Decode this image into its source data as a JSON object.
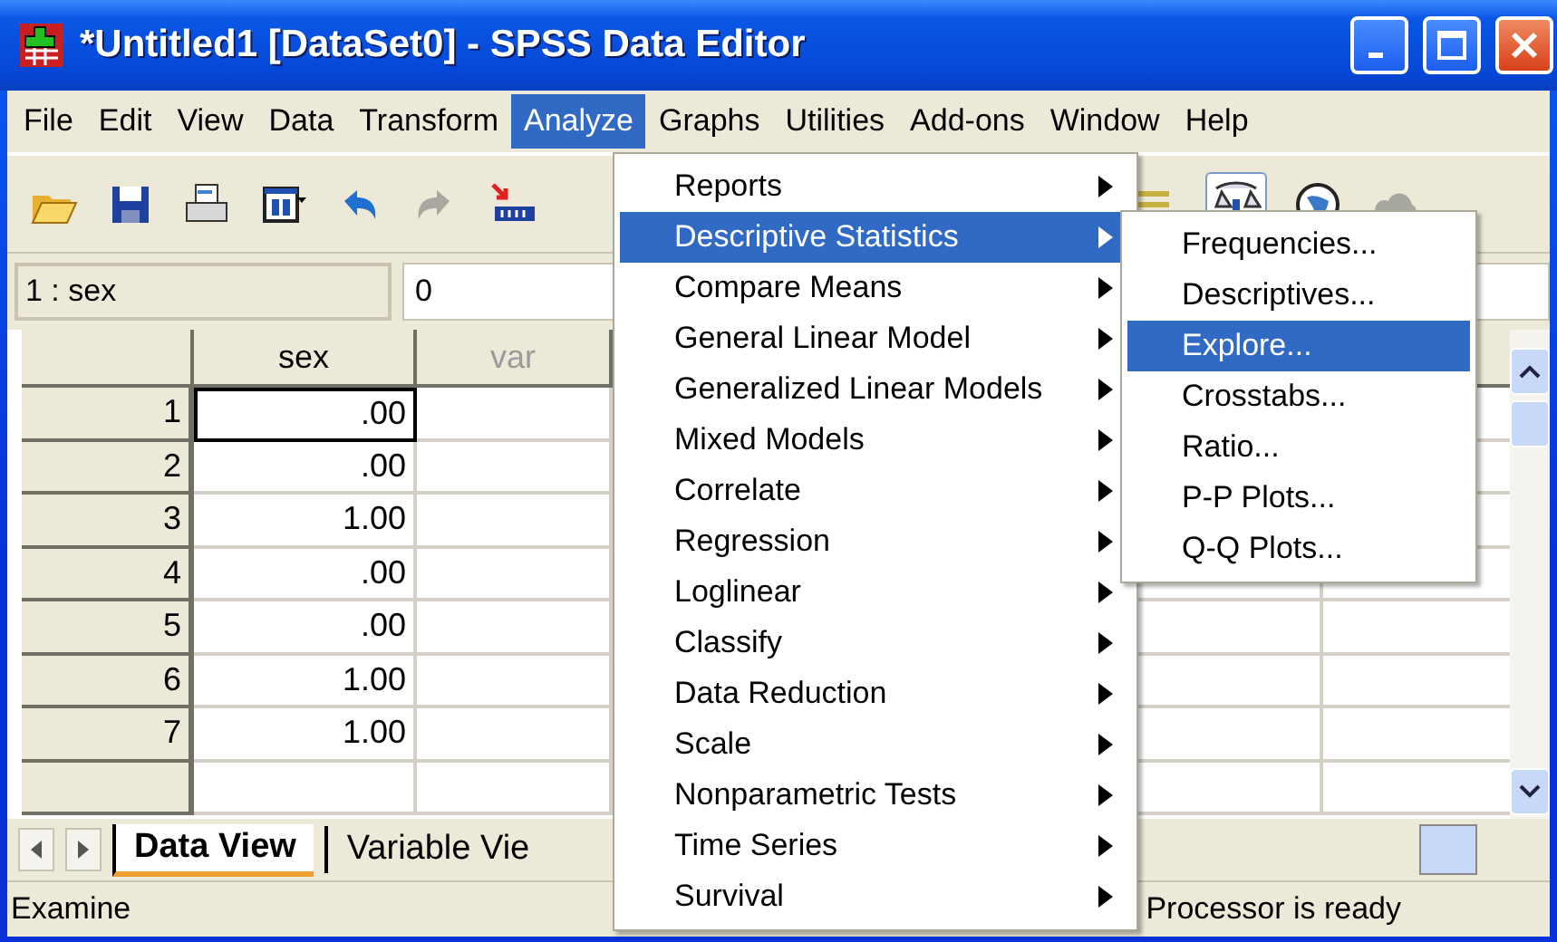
{
  "window": {
    "title": "*Untitled1 [DataSet0] - SPSS Data Editor"
  },
  "menubar": [
    {
      "label": "File",
      "selected": false
    },
    {
      "label": "Edit",
      "selected": false
    },
    {
      "label": "View",
      "selected": false
    },
    {
      "label": "Data",
      "selected": false
    },
    {
      "label": "Transform",
      "selected": false
    },
    {
      "label": "Analyze",
      "selected": true
    },
    {
      "label": "Graphs",
      "selected": false
    },
    {
      "label": "Utilities",
      "selected": false
    },
    {
      "label": "Add-ons",
      "selected": false
    },
    {
      "label": "Window",
      "selected": false
    },
    {
      "label": "Help",
      "selected": false
    }
  ],
  "cell_reference": {
    "name": "1 : sex",
    "value": "0"
  },
  "table": {
    "columns": [
      "sex",
      "var"
    ],
    "rows": [
      {
        "number": "1",
        "sex": ".00",
        "selected": true
      },
      {
        "number": "2",
        "sex": ".00",
        "selected": false
      },
      {
        "number": "3",
        "sex": "1.00",
        "selected": false
      },
      {
        "number": "4",
        "sex": ".00",
        "selected": false
      },
      {
        "number": "5",
        "sex": ".00",
        "selected": false
      },
      {
        "number": "6",
        "sex": "1.00",
        "selected": false
      },
      {
        "number": "7",
        "sex": "1.00",
        "selected": false
      }
    ]
  },
  "sheet_tabs": [
    {
      "label": "Data View",
      "selected": true
    },
    {
      "label": "Variable Vie",
      "selected": false
    }
  ],
  "status_bar": {
    "message": "Examine",
    "processor": "Processor is ready"
  },
  "analyze_menu": [
    {
      "label": "Reports",
      "selected": false
    },
    {
      "label": "Descriptive Statistics",
      "selected": true
    },
    {
      "label": "Compare Means",
      "selected": false
    },
    {
      "label": "General Linear Model",
      "selected": false
    },
    {
      "label": "Generalized Linear Models",
      "selected": false
    },
    {
      "label": "Mixed Models",
      "selected": false
    },
    {
      "label": "Correlate",
      "selected": false
    },
    {
      "label": "Regression",
      "selected": false
    },
    {
      "label": "Loglinear",
      "selected": false
    },
    {
      "label": "Classify",
      "selected": false
    },
    {
      "label": "Data Reduction",
      "selected": false
    },
    {
      "label": "Scale",
      "selected": false
    },
    {
      "label": "Nonparametric Tests",
      "selected": false
    },
    {
      "label": "Time Series",
      "selected": false
    },
    {
      "label": "Survival",
      "selected": false
    }
  ],
  "submenu": [
    {
      "label": "Frequencies...",
      "selected": false
    },
    {
      "label": "Descriptives...",
      "selected": false
    },
    {
      "label": "Explore...",
      "selected": true
    },
    {
      "label": "Crosstabs...",
      "selected": false
    },
    {
      "label": "Ratio...",
      "selected": false
    },
    {
      "label": "P-P Plots...",
      "selected": false
    },
    {
      "label": "Q-Q Plots...",
      "selected": false
    }
  ]
}
